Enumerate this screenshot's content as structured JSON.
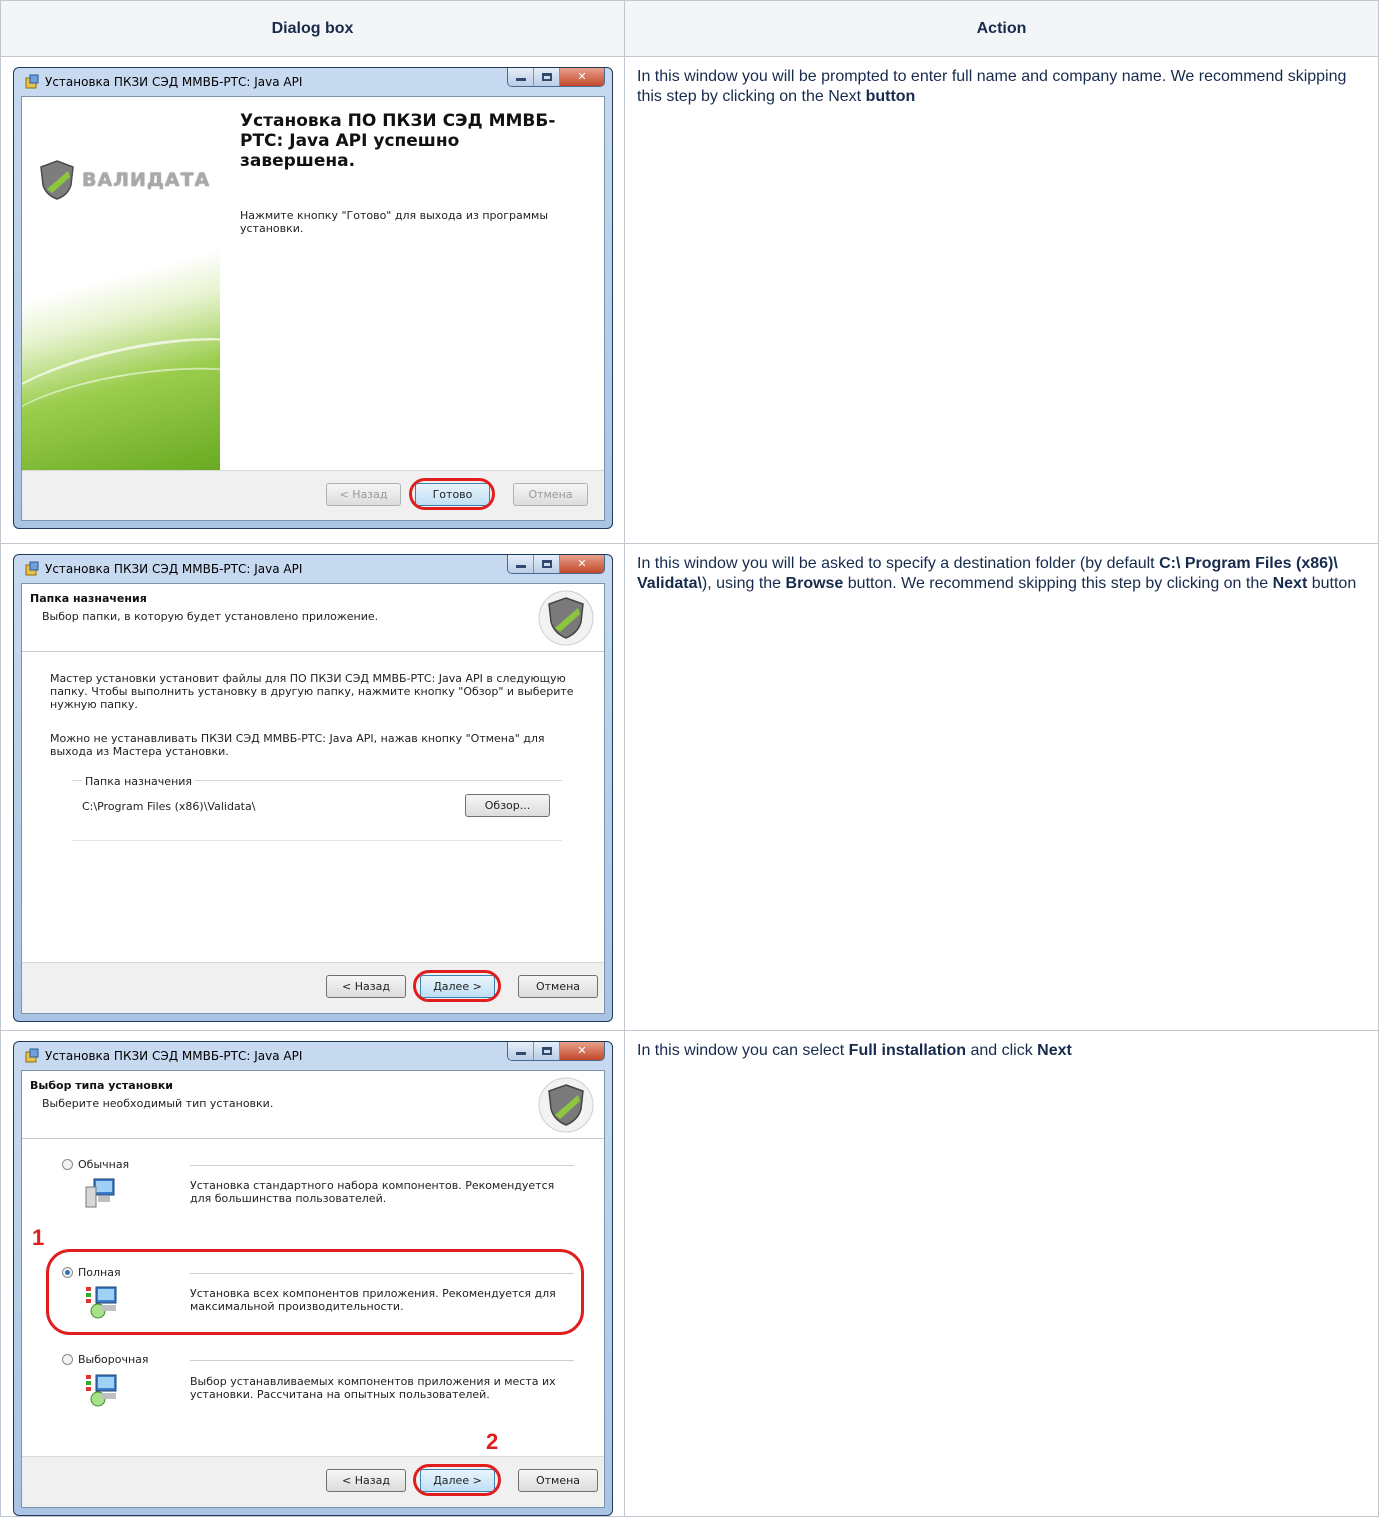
{
  "table": {
    "headers": [
      "Dialog box",
      "Action"
    ]
  },
  "window_title": "Установка ПКЗИ СЭД ММВБ-РТС: Java API",
  "buttons": {
    "back": "< Назад",
    "finish": "Готово",
    "next": "Далее >",
    "cancel": "Отмена",
    "browse": "Обзор..."
  },
  "dialog1": {
    "logo_text": "ВАЛИДАТА",
    "title": "Установка ПО ПКЗИ СЭД ММВБ-РТС: Java API успешно завершена.",
    "body": "Нажмите кнопку \"Готово\" для выхода из программы установки."
  },
  "dialog2": {
    "header_title": "Папка назначения",
    "header_subtitle": "Выбор папки, в которую будет установлено приложение.",
    "para1": "Мастер установки установит файлы для ПО ПКЗИ СЭД ММВБ-РТС: Java API в следующую папку. Чтобы выполнить установку в другую папку, нажмите кнопку \"Обзор\" и выберите нужную папку.",
    "para2": "Можно не устанавливать ПКЗИ СЭД ММВБ-РТС: Java API, нажав кнопку \"Отмена\" для выхода из Мастера установки.",
    "group_label": "Папка назначения",
    "folder_path": "C:\\Program Files (x86)\\Validata\\"
  },
  "dialog3": {
    "header_title": "Выбор типа установки",
    "header_subtitle": "Выберите необходимый тип установки.",
    "options": [
      {
        "label": "Обычная",
        "desc": "Установка стандартного набора компонентов. Рекомендуется для большинства пользователей."
      },
      {
        "label": "Полная",
        "desc": "Установка всех компонентов приложения. Рекомендуется для максимальной производительности."
      },
      {
        "label": "Выборочная",
        "desc": "Выбор устанавливаемых компонентов приложения и места их установки. Рассчитана на опытных пользователей."
      }
    ],
    "marker1": "1",
    "marker2": "2"
  },
  "actions": {
    "row1": {
      "t1": "In this window you will be prompted to enter full name and company name. We recommend skipping this step by clicking on the Next ",
      "b1": "button"
    },
    "row2": {
      "t1": "In this window you will be asked to specify a destination folder (by default ",
      "b1": "C:\\ Program Files (x86)\\ Validata\\",
      "t2": "), using the ",
      "b2": "Browse",
      "t3": " button. We recommend skipping this step by clicking on the ",
      "b3": "Next",
      "t4": " button"
    },
    "row3": {
      "t1": "In this window you can select ",
      "b1": "Full installation",
      "t2": " and click ",
      "b2": "Next"
    }
  }
}
